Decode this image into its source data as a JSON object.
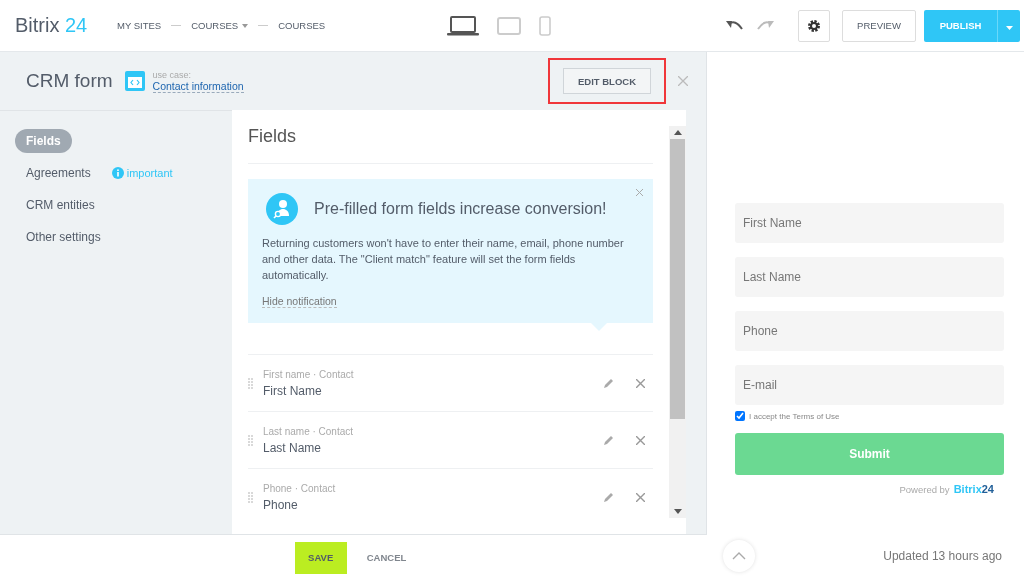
{
  "topbar": {
    "logo": {
      "name": "Bitrix",
      "number": "24"
    },
    "breadcrumbs": [
      {
        "label": "MY SITES",
        "dropdown": false
      },
      {
        "label": "COURSES",
        "dropdown": true
      },
      {
        "label": "COURSES",
        "dropdown": false
      }
    ],
    "devices": [
      {
        "kind": "desktop",
        "selected": true
      },
      {
        "kind": "tablet",
        "selected": false
      },
      {
        "kind": "phone",
        "selected": false
      }
    ],
    "preview": "PREVIEW",
    "publish": "PUBLISH"
  },
  "panel": {
    "title": "CRM form",
    "use_case_label": "use case:",
    "use_case": "Contact information",
    "edit_block": "EDIT BLOCK"
  },
  "menu": [
    {
      "label": "Fields",
      "selected": true
    },
    {
      "label": "Agreements",
      "selected": false,
      "badge": "important"
    },
    {
      "label": "CRM entities",
      "selected": false
    },
    {
      "label": "Other settings",
      "selected": false
    }
  ],
  "content": {
    "title": "Fields",
    "notice": {
      "title": "Pre-filled form fields increase conversion!",
      "text": "Returning customers won't have to enter their name, email, phone number and other data. The \"Client match\" feature will set the form fields automatically.",
      "link": "Hide notification"
    },
    "fields": [
      {
        "meta": "First name · Contact",
        "name": "First Name"
      },
      {
        "meta": "Last name · Contact",
        "name": "Last Name"
      },
      {
        "meta": "Phone · Contact",
        "name": "Phone"
      }
    ]
  },
  "footer": {
    "save": "SAVE",
    "cancel": "CANCEL"
  },
  "preview_form": {
    "placeholders": [
      "First Name",
      "Last Name",
      "Phone",
      "E-mail"
    ],
    "terms": {
      "label": "I accept the Terms of Use",
      "checked": true
    },
    "submit": "Submit",
    "powered_by": "Powered by",
    "brand": {
      "name": "Bitrix",
      "number": "24"
    },
    "updated": "Updated 13 hours ago"
  }
}
